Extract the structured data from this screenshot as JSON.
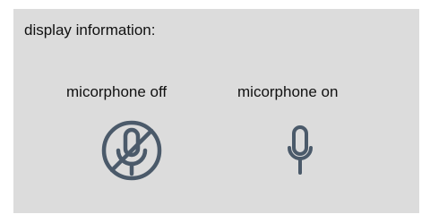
{
  "panel": {
    "heading": "display information:"
  },
  "states": {
    "off": {
      "label": "micorphone off",
      "icon": "microphone-off-icon"
    },
    "on": {
      "label": "micorphone on",
      "icon": "microphone-icon"
    }
  },
  "colors": {
    "panel_background": "#dcdcdc",
    "icon": "#4b5a6a",
    "text": "#111111"
  }
}
